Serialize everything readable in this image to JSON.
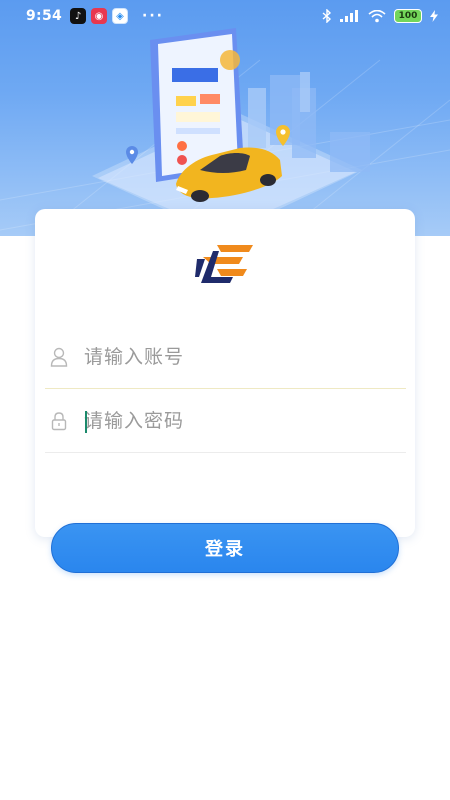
{
  "status_bar": {
    "time": "9:54",
    "signal_label": ".all",
    "battery": "100"
  },
  "hero": {
    "illustration": "phone-with-car-and-map-pins",
    "accent": "#5b9bf0"
  },
  "login": {
    "account_placeholder": "请输入账号",
    "password_placeholder": "请输入密码",
    "button_label": "登录"
  },
  "colors": {
    "primary": "#2a86ee",
    "logo_orange": "#f08a1c",
    "logo_navy": "#1f2b6b"
  },
  "icons": {
    "user": "user-icon",
    "lock": "lock-icon"
  }
}
